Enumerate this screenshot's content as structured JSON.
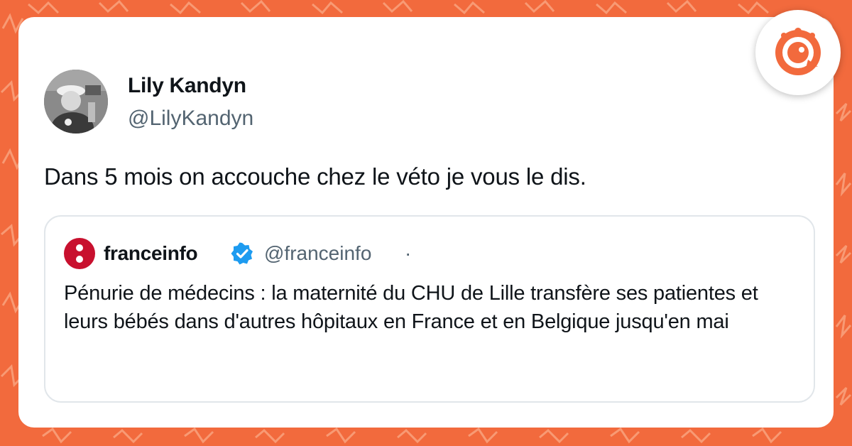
{
  "tweet": {
    "author": {
      "name": "Lily Kandyn",
      "handle": "@LilyKandyn"
    },
    "text": "Dans 5 mois on accouche chez le véto je vous le dis.",
    "quoted": {
      "author_name": "franceinfo",
      "handle": "@franceinfo",
      "separator": "·",
      "verified": true,
      "text": "Pénurie de médecins : la maternité du CHU de Lille transfère ses patientes et leurs bébés dans d'autres hôpitaux en France et en Belgique jusqu'en mai"
    }
  },
  "icons": {
    "badge": "orange-chat-bird-logo-icon",
    "quoted_logo": "franceinfo-logo-icon",
    "verified": "verified-badge-icon"
  },
  "colors": {
    "background": "#f26a3d",
    "card": "#ffffff",
    "brand_orange": "#f26a3d",
    "franceinfo_red": "#c8102e",
    "verified_blue": "#1d9bf0",
    "text_primary": "#0f1419",
    "text_secondary": "#536471"
  }
}
